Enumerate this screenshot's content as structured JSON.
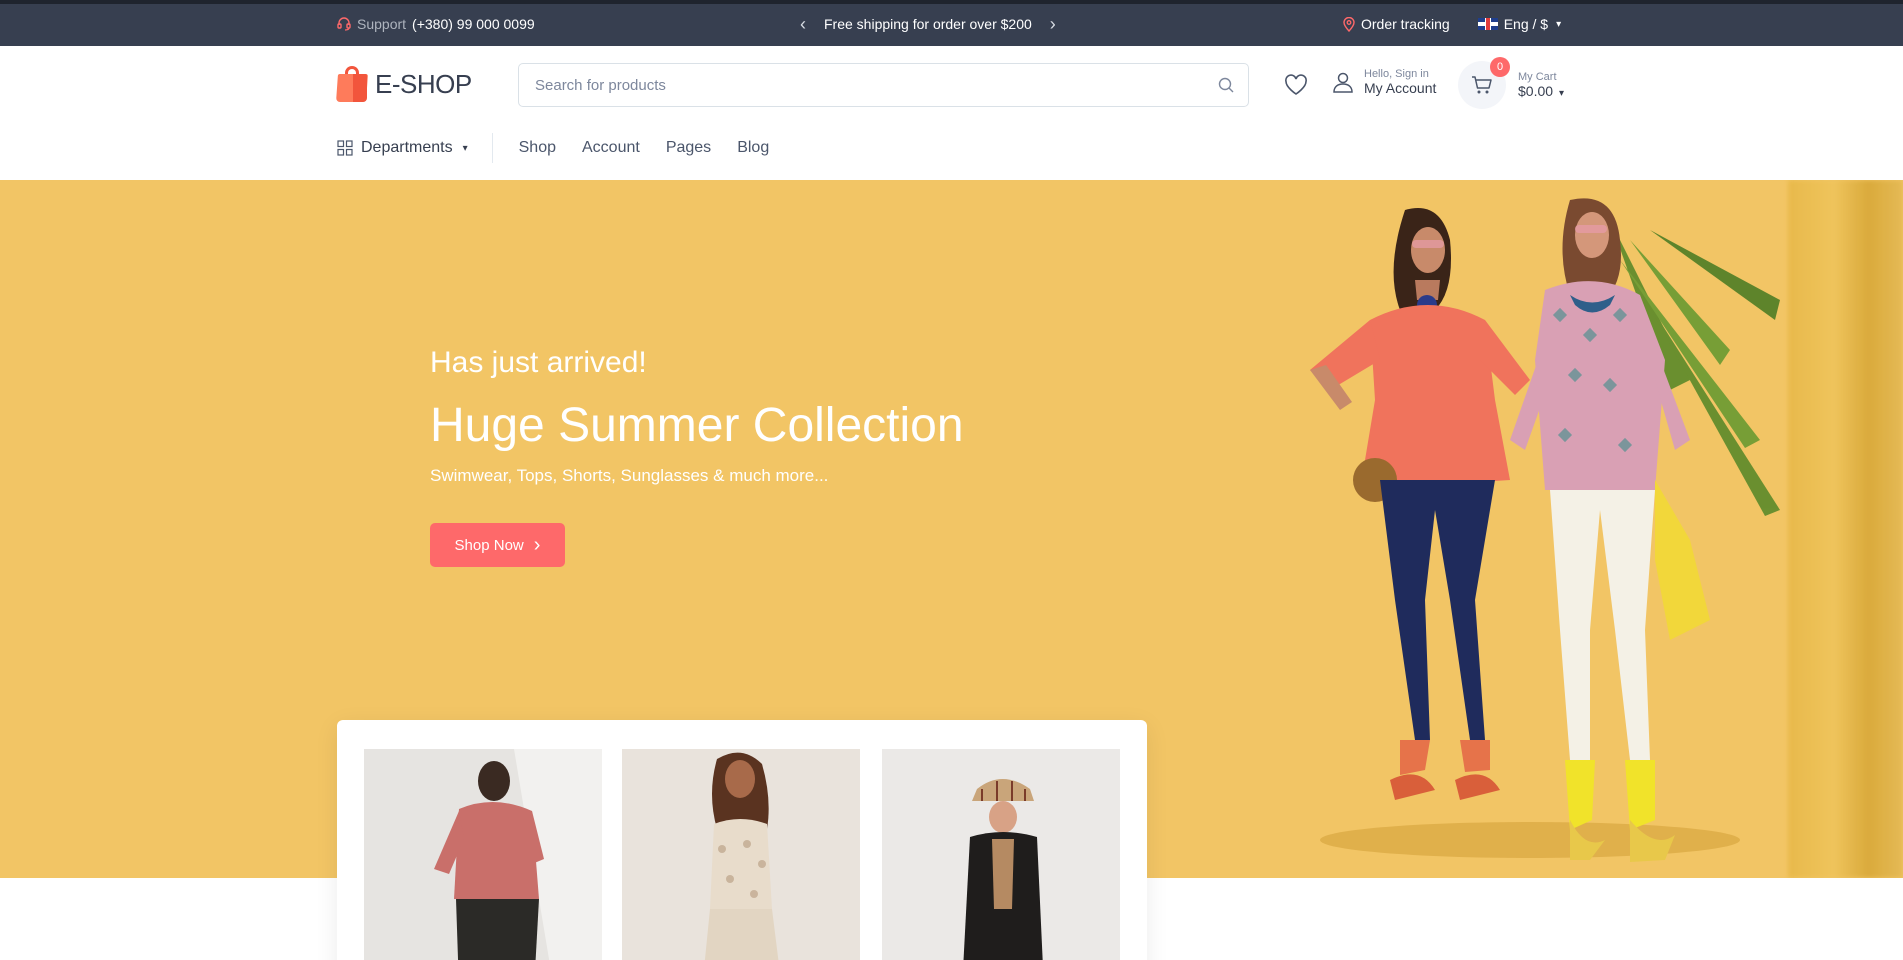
{
  "topbar": {
    "support_label": "Support",
    "support_phone": "(+380) 99 000 0099",
    "promo": "Free shipping for order over $200",
    "order_tracking": "Order tracking",
    "language_currency": "Eng / $"
  },
  "header": {
    "logo_text": "E-SHOP",
    "search_placeholder": "Search for products",
    "account_greeting": "Hello, Sign in",
    "account_label": "My Account",
    "cart_count": "0",
    "cart_label": "My Cart",
    "cart_total": "$0.00"
  },
  "nav": {
    "departments": "Departments",
    "links": [
      "Shop",
      "Account",
      "Pages",
      "Blog"
    ]
  },
  "hero": {
    "subtitle": "Has just arrived!",
    "title": "Huge Summer Collection",
    "description": "Swimwear, Tops, Shorts, Sunglasses & much more...",
    "button": "Shop Now"
  },
  "colors": {
    "topbar": "#373f50",
    "accent": "#fe696a",
    "hero_bg": "#f2c565"
  }
}
